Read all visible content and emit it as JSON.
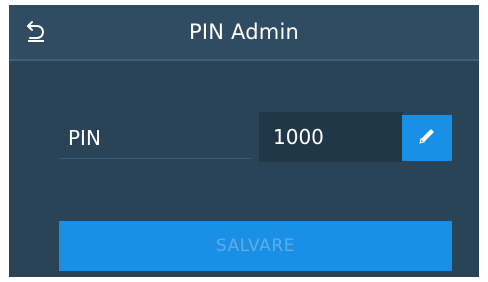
{
  "header": {
    "title": "PIN Admin",
    "back_icon": "back-arrow-icon"
  },
  "form": {
    "pin_label": "PIN",
    "pin_value": "1000",
    "edit_icon": "pencil-icon"
  },
  "actions": {
    "save_label": "SALVARE",
    "save_enabled": false
  },
  "colors": {
    "background": "#2a4357",
    "header": "#304c63",
    "input": "#203748",
    "accent": "#1a8fe6",
    "disabled_text": "#5eaee6"
  }
}
